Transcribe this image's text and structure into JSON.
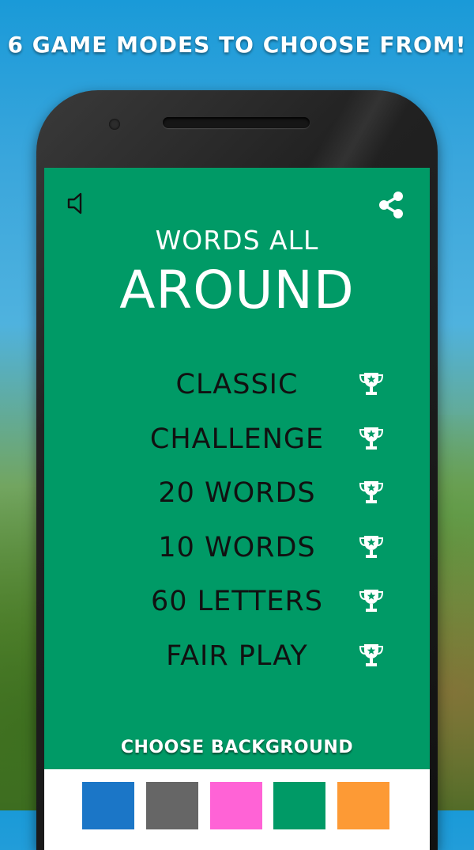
{
  "promo": {
    "headline": "6 GAME MODES TO CHOOSE FROM!"
  },
  "app": {
    "title_line1": "WORDS ALL",
    "title_line2": "AROUND",
    "bg_color": "#009a66"
  },
  "toolbar": {
    "mute_icon": "speaker-icon",
    "share_icon": "share-icon"
  },
  "modes": [
    {
      "label": "CLASSIC",
      "icon": "trophy-icon"
    },
    {
      "label": "CHALLENGE",
      "icon": "trophy-icon"
    },
    {
      "label": "20 WORDS",
      "icon": "trophy-icon"
    },
    {
      "label": "10 WORDS",
      "icon": "trophy-icon"
    },
    {
      "label": "60 LETTERS",
      "icon": "trophy-icon"
    },
    {
      "label": "FAIR PLAY",
      "icon": "trophy-icon"
    }
  ],
  "background_picker": {
    "label": "CHOOSE BACKGROUND",
    "colors": [
      "#1b76c7",
      "#666666",
      "#ff63d6",
      "#009a66",
      "#fd9a35"
    ]
  }
}
